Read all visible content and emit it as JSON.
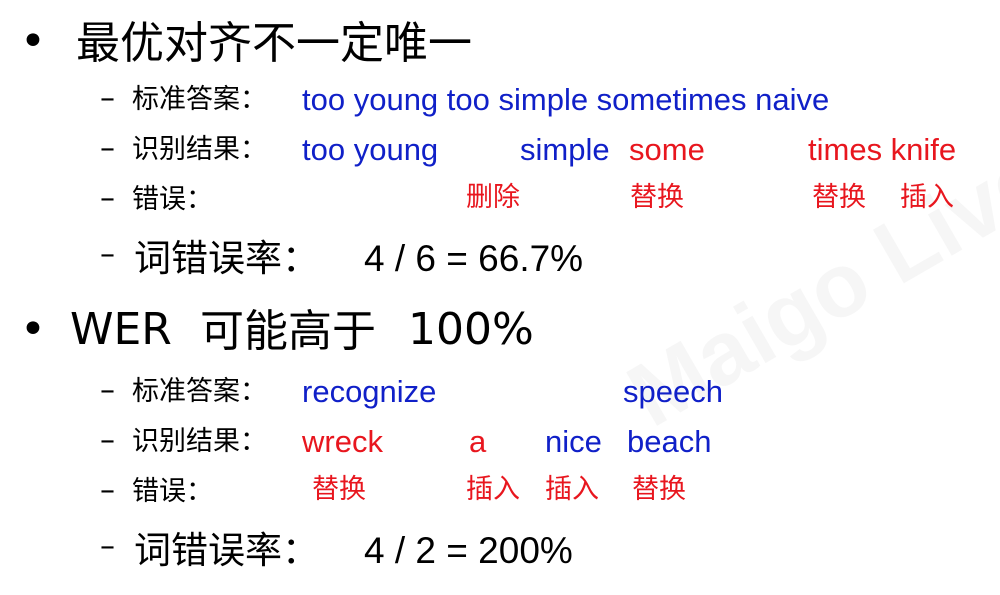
{
  "watermark": {
    "text": "Maigo Live 土豆 知乎 Live"
  },
  "section1": {
    "bullet": "•",
    "title": "最优对齐不一定唯一",
    "ref_label": "标准答案：",
    "ref_text": "too young too simple sometimes naive",
    "hyp_label": "识别结果：",
    "hyp_blue1": "too young",
    "hyp_blue2": "simple",
    "hyp_red1": "some",
    "hyp_red2": "times knife",
    "err_label": "错误：",
    "err_delete": "删除",
    "err_sub1": "替换",
    "err_sub2": "替换",
    "err_ins": "插入",
    "wer_label": "词错误率：",
    "wer_value": "4 / 6 = 66.7%"
  },
  "section2": {
    "bullet": "•",
    "title_latin": "WER",
    "title_cjk": "可能高于",
    "title_num": "100%",
    "ref_label": "标准答案：",
    "ref_word1": "recognize",
    "ref_word2": "speech",
    "hyp_label": "识别结果：",
    "hyp_red1": "wreck",
    "hyp_red2": "a",
    "hyp_blue1": "nice",
    "hyp_blue2": "beach",
    "err_label": "错误：",
    "err_sub1": "替换",
    "err_ins1": "插入",
    "err_ins2": "插入",
    "err_sub2": "替换",
    "wer_label": "词错误率：",
    "wer_value": "4 / 2 = 200%"
  },
  "dash": "–",
  "colors": {
    "blue": "#1020c8",
    "red": "#e8161e",
    "text": "#000000"
  }
}
